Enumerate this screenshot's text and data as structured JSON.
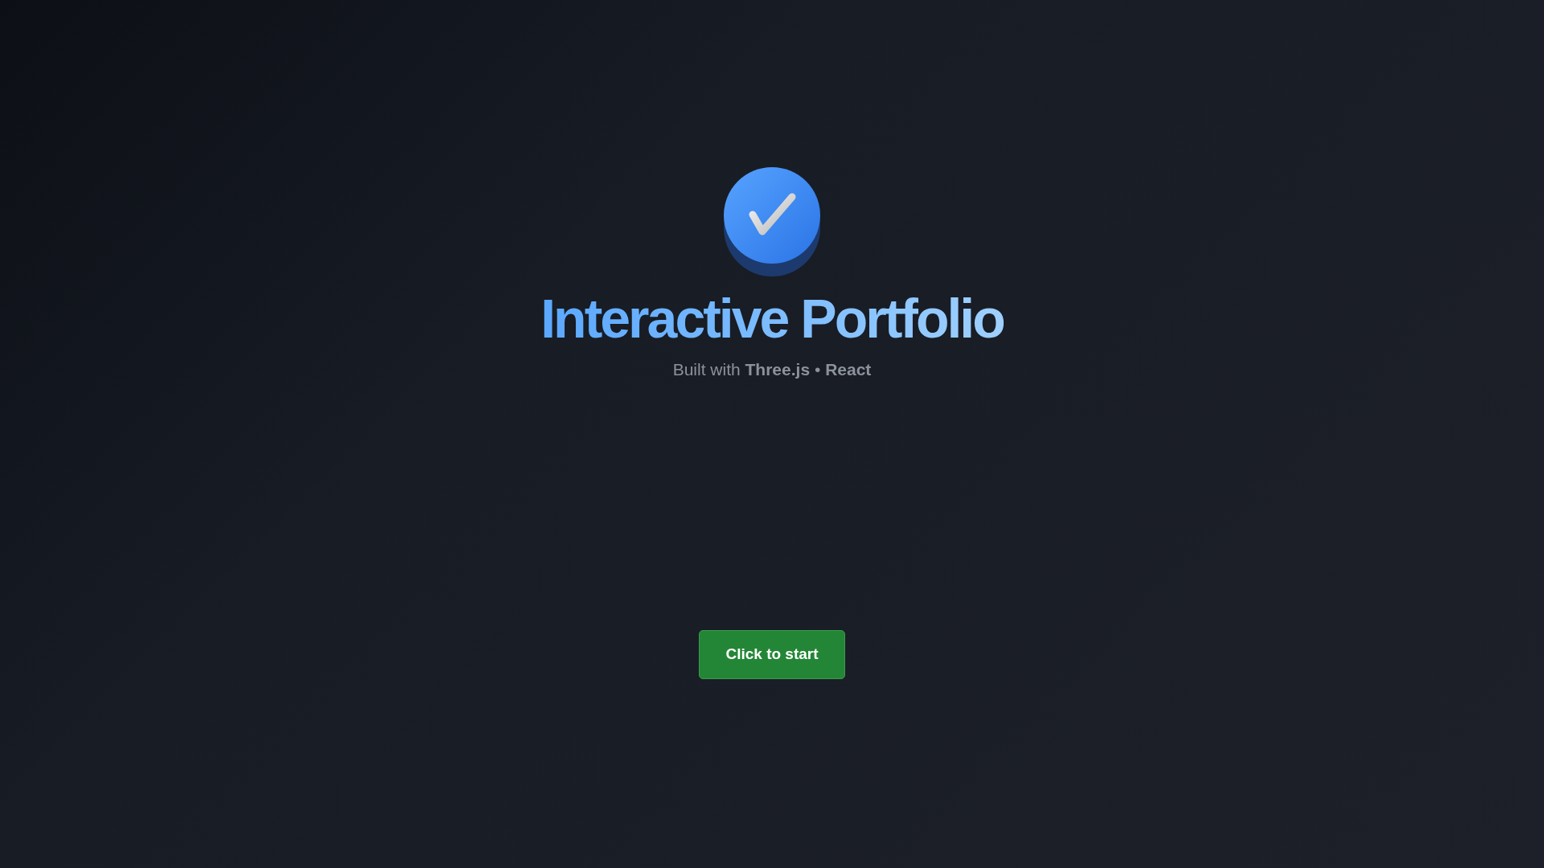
{
  "title": "Interactive Portfolio",
  "subtitle": "Built with **Three.js** • **React**",
  "start_button": {
    "label": "Click to start"
  }
}
